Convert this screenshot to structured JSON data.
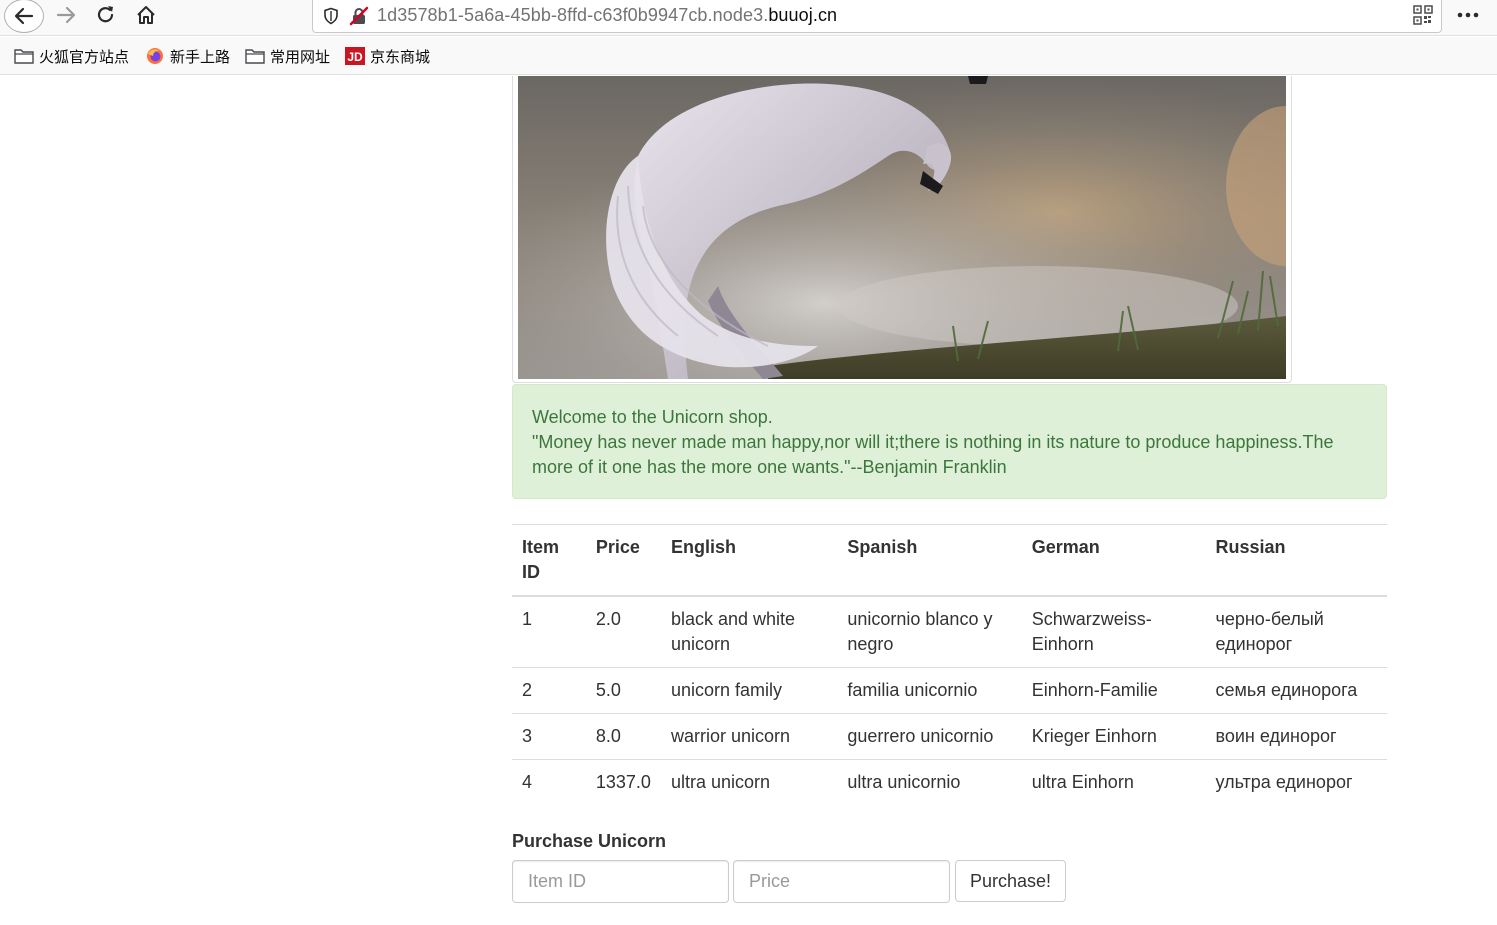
{
  "browser": {
    "url_path": "1d3578b1-5a6a-45bb-8ffd-c63f0b9947cb.node3.",
    "url_host": "buuoj.cn",
    "bookmarks": [
      {
        "label": "火狐官方站点",
        "icon": "folder-icon"
      },
      {
        "label": "新手上路",
        "icon": "firefox-icon"
      },
      {
        "label": "常用网址",
        "icon": "folder-icon"
      },
      {
        "label": "京东商城",
        "icon": "jd-icon"
      }
    ]
  },
  "alert": {
    "line1": "Welcome to the Unicorn shop.",
    "line2": "\"Money has never made man happy,nor will it;there is nothing in its nature to produce happiness.The more of it one has the more one wants.\"--Benjamin Franklin",
    "color": "#3c763d",
    "background": "#dff0d8"
  },
  "table": {
    "headers": [
      "Item ID",
      "Price",
      "English",
      "Spanish",
      "German",
      "Russian"
    ],
    "rows": [
      [
        "1",
        "2.0",
        "black and white unicorn",
        "unicornio blanco y negro",
        "Schwarzweiss-Einhorn",
        "черно-белый единорог"
      ],
      [
        "2",
        "5.0",
        "unicorn family",
        "familia unicornio",
        "Einhorn-Familie",
        "семья единорога"
      ],
      [
        "3",
        "8.0",
        "warrior unicorn",
        "guerrero unicornio",
        "Krieger Einhorn",
        "воин единорог"
      ],
      [
        "4",
        "1337.0",
        "ultra unicorn",
        "ultra unicornio",
        "ultra Einhorn",
        "ультра единорог"
      ]
    ]
  },
  "form": {
    "title": "Purchase Unicorn",
    "id_placeholder": "Item ID",
    "price_placeholder": "Price",
    "submit_label": "Purchase!"
  }
}
